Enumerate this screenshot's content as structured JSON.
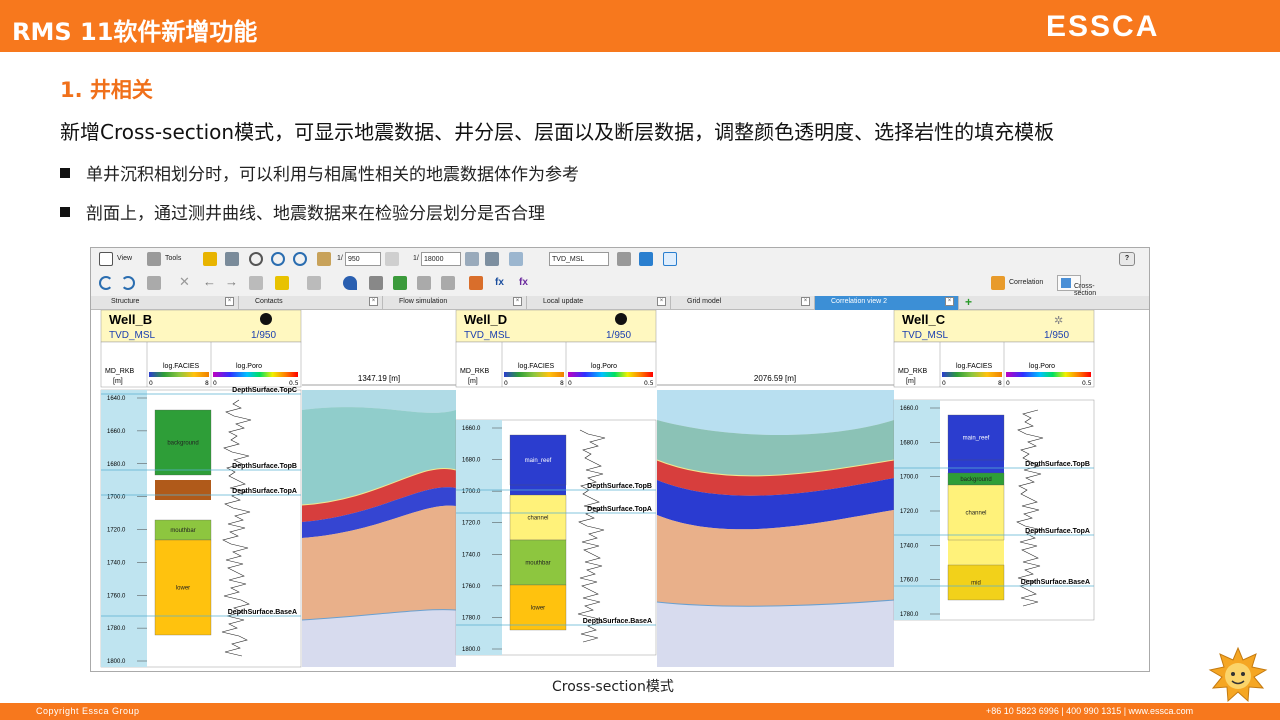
{
  "header": {
    "title": "RMS 11软件新增功能",
    "logo": "ESSCA"
  },
  "section_title": "1. 井相关",
  "intro": "新增Cross-section模式，可显示地震数据、井分层、层面以及断层数据，调整颜色透明度、选择岩性的填充模板",
  "bullets": [
    "单井沉积相划分时，可以利用与相属性相关的地震数据体作为参考",
    "剖面上，通过测井曲线、地震数据来在检验分层划分是否合理"
  ],
  "app": {
    "toolbar1": {
      "view": "View",
      "tools": "Tools",
      "scale_a": "1/",
      "scale_a_value": "950",
      "scale_b": "1/",
      "scale_b_value": "18000",
      "depth_mode": "TVD_MSL",
      "help": "?"
    },
    "toolbar2": {
      "correlation": "Correlation",
      "cross_section": "Cross-section"
    },
    "tabs": [
      "Structure",
      "Contacts",
      "Flow simulation",
      "Local update",
      "Grid model",
      "Correlation view 2"
    ],
    "wells": [
      {
        "name": "Well_B",
        "mode": "TVD_MSL",
        "scale": "1/950",
        "symbol": "filled",
        "tracks": [
          "log.FACIES",
          "log.Poro"
        ],
        "track_min": [
          "0",
          "0"
        ],
        "track_max": [
          "8",
          "0.5"
        ],
        "md_label": "MD_RKB",
        "md_unit": "[m]",
        "depth_ticks": [
          "1640.0",
          "1660.0",
          "1680.0",
          "1700.0",
          "1720.0",
          "1740.0",
          "1760.0",
          "1780.0",
          "1800.0"
        ],
        "facies": [
          {
            "label": "background",
            "color": "#2e9e38"
          },
          {
            "label": "mouthbar",
            "color": "#8dc63f"
          },
          {
            "label": "lower",
            "color": "#ffc20e"
          }
        ],
        "surfaces": [
          "DepthSurface.TopC",
          "DepthSurface.TopB",
          "DepthSurface.TopA",
          "DepthSurface.BaseA"
        ]
      },
      {
        "name": "Well_D",
        "mode": "TVD_MSL",
        "scale": "1/950",
        "symbol": "filled",
        "tracks": [
          "log.FACIES",
          "log.Poro"
        ],
        "track_min": [
          "0",
          "0"
        ],
        "track_max": [
          "8",
          "0.5"
        ],
        "md_label": "MD_RKB",
        "md_unit": "[m]",
        "depth_ticks": [
          "1660.0",
          "1680.0",
          "1700.0",
          "1720.0",
          "1740.0",
          "1760.0",
          "1780.0",
          "1800.0"
        ],
        "facies": [
          {
            "label": "main_reef",
            "color": "#2b3dcf"
          },
          {
            "label": "channel",
            "color": "#fff27a"
          },
          {
            "label": "mouthbar",
            "color": "#8dc63f"
          },
          {
            "label": "lower",
            "color": "#ffc20e"
          }
        ],
        "surfaces": [
          "DepthSurface.TopB",
          "DepthSurface.TopA",
          "DepthSurface.BaseA"
        ]
      },
      {
        "name": "Well_C",
        "mode": "TVD_MSL",
        "scale": "1/950",
        "symbol": "sun",
        "tracks": [
          "log.FACIES",
          "log.Poro"
        ],
        "track_min": [
          "0",
          "0"
        ],
        "track_max": [
          "8",
          "0.5"
        ],
        "md_label": "MD_RKB",
        "md_unit": "[m]",
        "depth_ticks": [
          "1660.0",
          "1680.0",
          "1700.0",
          "1720.0",
          "1740.0",
          "1760.0",
          "1780.0"
        ],
        "facies": [
          {
            "label": "main_reef",
            "color": "#2b3dcf"
          },
          {
            "label": "background",
            "color": "#2e9e38"
          },
          {
            "label": "channel",
            "color": "#fff27a"
          },
          {
            "label": "mid",
            "color": "#f2d11a"
          }
        ],
        "surfaces": [
          "DepthSurface.TopB",
          "DepthSurface.TopA",
          "DepthSurface.BaseA"
        ]
      }
    ],
    "distances": [
      "1347.19 [m]",
      "2076.59 [m]"
    ]
  },
  "caption": "Cross-section模式",
  "footer": {
    "left": "Copyright  Essca Group",
    "right": "+86 10 5823 6996  | 400 990 1315 | www.essca.com"
  }
}
